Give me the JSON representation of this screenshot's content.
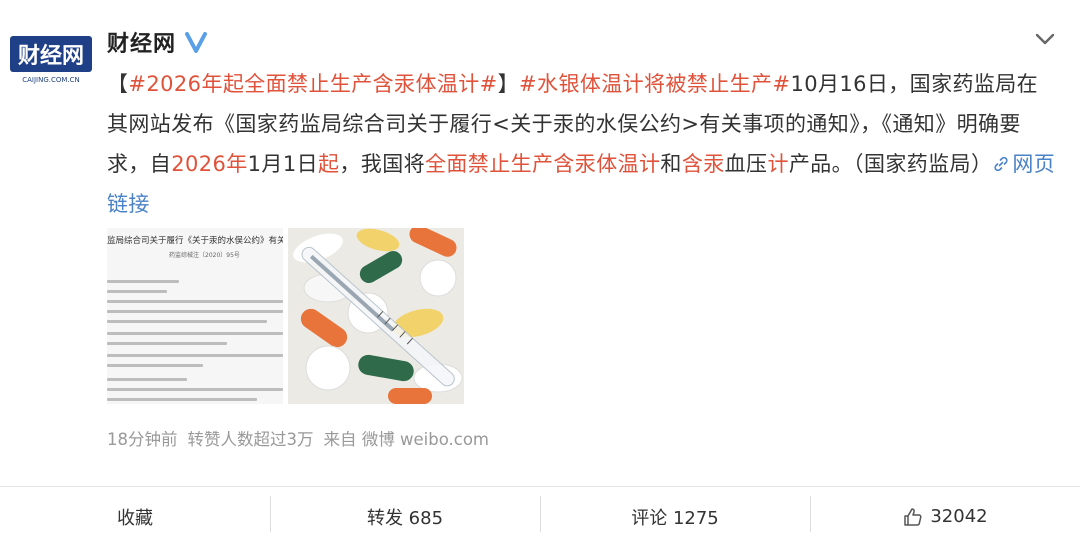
{
  "post": {
    "username": "财经网",
    "avatar_text": "财经网",
    "avatar_sub": "CAIJING.COM.CN",
    "content": {
      "bracket_open": "【",
      "tag1": "#2026年起全面禁止生产含汞体温计#",
      "bracket_close": "】",
      "tag2": "#水银体温计将被禁止生产#",
      "t1": "10月16日，国家药监局在其网站发布《国家药监局综合司关于履行<关于汞的水俣公约>有关事项的通知》，《通知》明确要求，自",
      "hl_year": "2026年",
      "t2": "1月1日",
      "hl_qi": "起",
      "t3": "，我国将",
      "hl_phrase": "全面禁止生产含汞体温计",
      "t4": "和",
      "hl_hangong": "含汞",
      "t5": "血压",
      "hl_ji": "计",
      "t6": "产品。（国家药监局）",
      "link": "网页链接"
    },
    "image1": {
      "title": "监局综合司关于履行《关于汞的水俣公约》有关事项",
      "subtitle": "药监综械注〔2020〕95号"
    },
    "meta": {
      "time": "18分钟前",
      "reposts_note": "转赞人数超过3万",
      "source": "来自 微博 weibo.com"
    }
  },
  "actions": {
    "favorite": "收藏",
    "repost": "转发 685",
    "comment": "评论 1275",
    "like": "32042"
  },
  "colors": {
    "highlight": "#e0523a",
    "link": "#4a82c8",
    "verified": "#5aa0e6",
    "meta": "#999999"
  },
  "icons": [
    "verified-icon",
    "chevron-down-icon",
    "link-icon",
    "thumbs-up-icon"
  ]
}
